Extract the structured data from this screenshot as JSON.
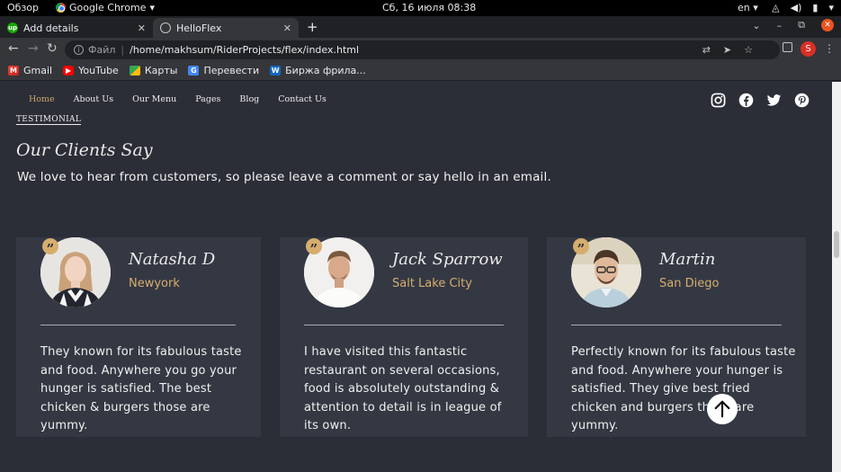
{
  "os": {
    "overview": "Обзор",
    "app_name": "Google Chrome",
    "clock": "Сб, 16 июля  08:38",
    "lang": "en"
  },
  "tabs": [
    {
      "title": "Add details",
      "icon": "upwork-icon",
      "active": false
    },
    {
      "title": "HelloFlex",
      "icon": "globe-icon",
      "active": true
    }
  ],
  "address": {
    "scheme_label": "Файл",
    "url": "/home/makhsum/RiderProjects/flex/index.html",
    "profile_initial": "S"
  },
  "bookmarks": [
    {
      "label": "Gmail",
      "icon": "gmail-icon"
    },
    {
      "label": "YouTube",
      "icon": "youtube-icon"
    },
    {
      "label": "Карты",
      "icon": "maps-icon"
    },
    {
      "label": "Перевести",
      "icon": "translate-icon"
    },
    {
      "label": "Биржа фрила...",
      "icon": "w-icon"
    }
  ],
  "site_nav": {
    "items": [
      "Home",
      "About Us",
      "Our Menu",
      "Pages",
      "Blog",
      "Contact Us"
    ],
    "active_index": 0,
    "social": [
      "instagram-icon",
      "facebook-icon",
      "twitter-icon",
      "pinterest-icon"
    ]
  },
  "testimonial": {
    "eyebrow": "TESTIMONIAL",
    "heading": "Our Clients Say",
    "lead": "We love to hear from customers, so please leave a comment or say hello in an email.",
    "cards": [
      {
        "name": "Natasha D",
        "city": "Newyork",
        "lines": [
          "They known for its fabulous taste",
          "and food. Anywhere you go your",
          "hunger is satisfied. The best",
          "chicken & burgers those are",
          "yummy."
        ]
      },
      {
        "name": "Jack Sparrow",
        "city": "Salt Lake City",
        "lines": [
          "I have visited this fantastic",
          "restaurant on several occasions,",
          "food is absolutely outstanding &",
          "attention to detail is in league of",
          "its own."
        ]
      },
      {
        "name": "Martin",
        "city": "San Diego",
        "lines": [
          "Perfectly known for its fabulous taste",
          "and food. Anywhere your hunger is",
          "satisfied. They give best fried",
          "chicken and burgers those are",
          "yummy."
        ]
      }
    ]
  },
  "colors": {
    "page_bg": "#2b2e37",
    "card_bg": "#343843",
    "accent": "#d6ad6e",
    "nav_active": "#c8a36a"
  }
}
